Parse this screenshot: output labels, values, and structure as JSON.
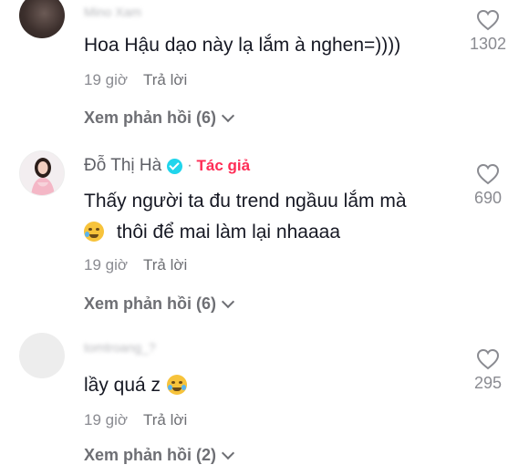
{
  "comments": [
    {
      "username": "Mino Xam",
      "text": "Hoa Hậu dạo này lạ lắm à nghen=))))",
      "time": "19 giờ",
      "reply_label": "Trả lời",
      "view_replies": "Xem phản hồi (6)",
      "likes": "1302"
    },
    {
      "username": "Đỗ Thị Hà",
      "author_badge": "Tác giả",
      "separator": "·",
      "text_line1": "Thấy người ta đu trend ngầuu lắm mà",
      "text_line2": "thôi để mai làm lại nhaaaa",
      "time": "19 giờ",
      "reply_label": "Trả lời",
      "view_replies": "Xem phản hồi (6)",
      "likes": "690"
    },
    {
      "username": "tomtroang_?",
      "text": "lầy quá z",
      "time": "19 giờ",
      "reply_label": "Trả lời",
      "view_replies": "Xem phản hồi (2)",
      "likes": "295"
    }
  ],
  "icons": {
    "like": "heart-outline-icon",
    "verified": "verified-badge-icon",
    "expand": "chevron-down-icon"
  },
  "colors": {
    "author_badge": "#fe2c55",
    "verified": "#20d5ec",
    "secondary_text": "#8a8b91"
  }
}
